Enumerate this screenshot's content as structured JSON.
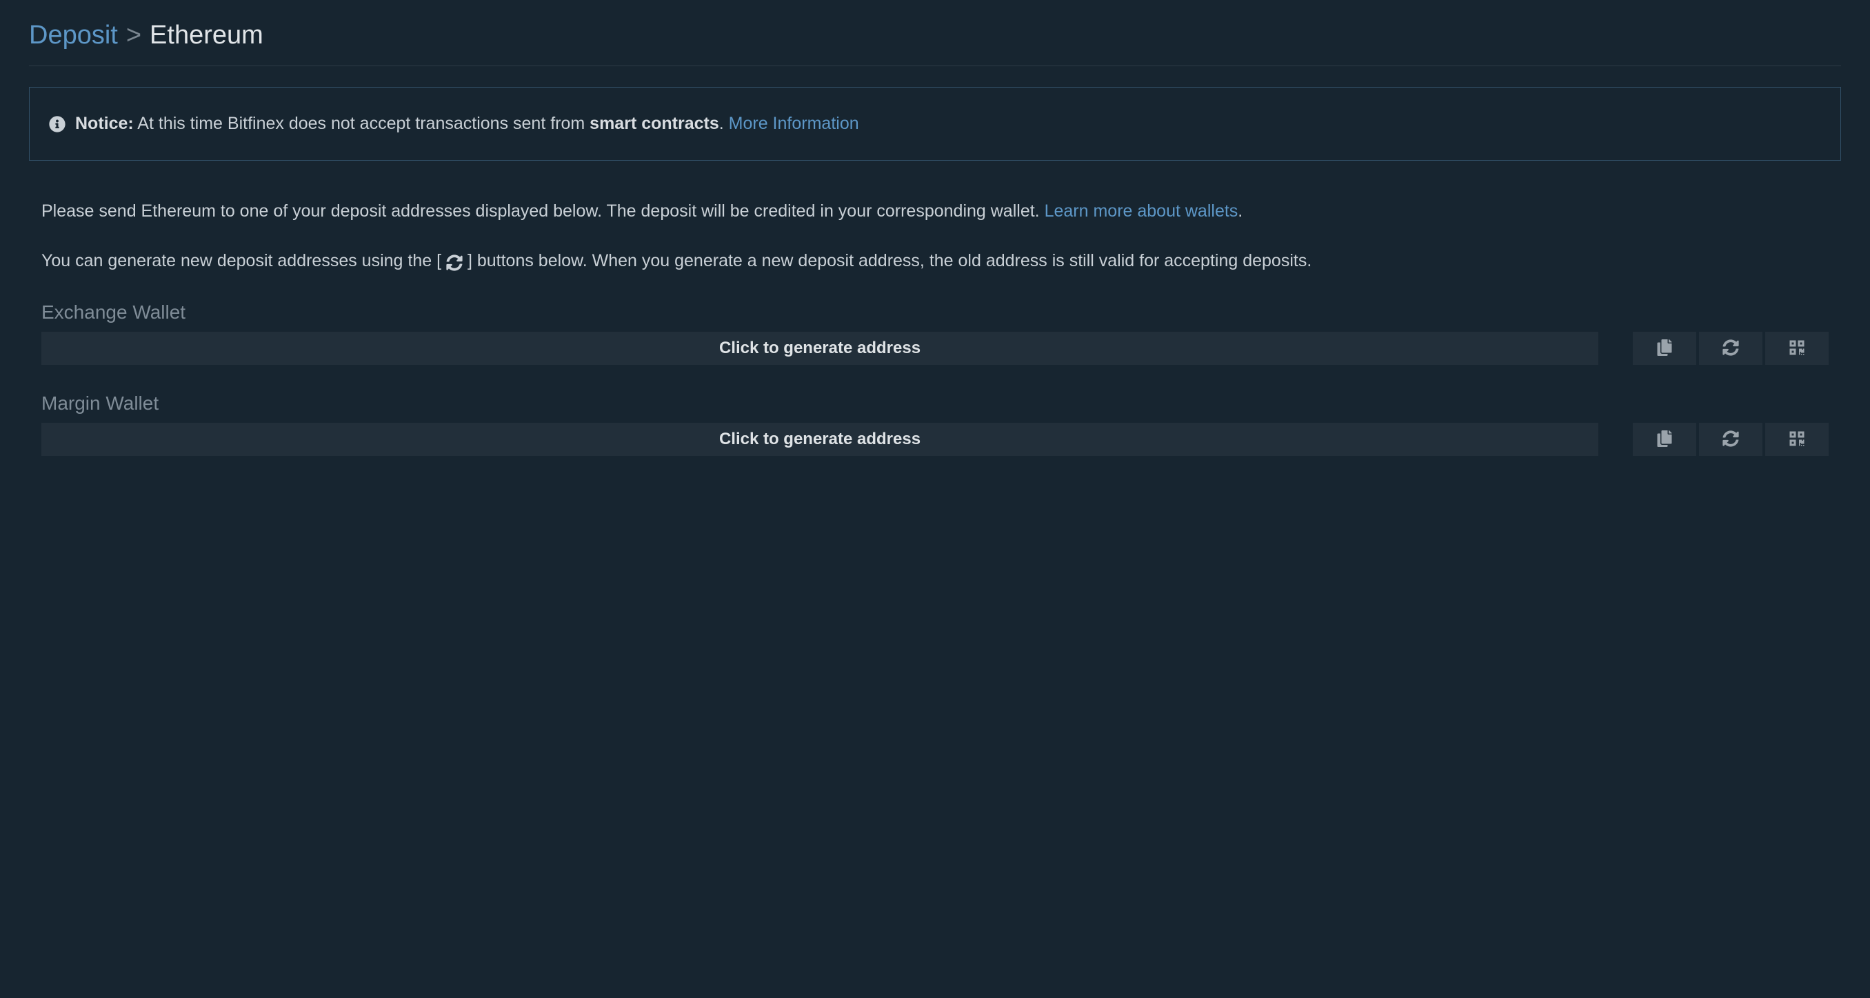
{
  "breadcrumb": {
    "root": "Deposit",
    "separator": ">",
    "current": "Ethereum"
  },
  "notice": {
    "label": "Notice:",
    "text_before_bold": " At this time Bitfinex does not accept transactions sent from ",
    "bold": "smart contracts",
    "text_after_bold": ". ",
    "link": "More Information"
  },
  "para1": {
    "before_link": "Please send Ethereum to one of your deposit addresses displayed below. The deposit will be credited in your corresponding wallet. ",
    "link": "Learn more about wallets",
    "after_link": "."
  },
  "para2": {
    "before_icon": "You can generate new deposit addresses using the [ ",
    "after_icon": " ] buttons below. When you generate a new deposit address, the old address is still valid for accepting deposits."
  },
  "wallets": [
    {
      "label": "Exchange Wallet",
      "button": "Click to generate address"
    },
    {
      "label": "Margin Wallet",
      "button": "Click to generate address"
    }
  ],
  "icons": {
    "info": "info-icon",
    "copy": "copy-icon",
    "refresh": "refresh-icon",
    "qr": "qr-icon"
  }
}
